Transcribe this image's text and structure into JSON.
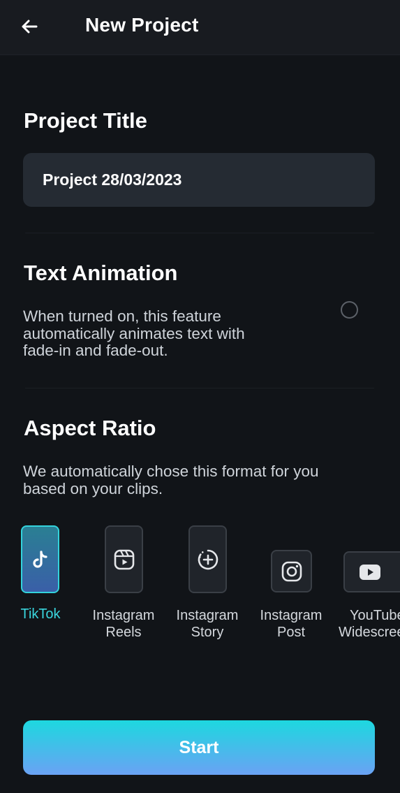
{
  "header": {
    "title": "New Project",
    "back_icon": "arrow-left-icon"
  },
  "project_title": {
    "heading": "Project Title",
    "value": "Project 28/03/2023"
  },
  "text_animation": {
    "heading": "Text Animation",
    "description_lines": [
      "When turned on, this feature",
      "automatically animates text with",
      "fade-in and fade-out."
    ],
    "enabled": false
  },
  "aspect_ratio": {
    "heading": "Aspect Ratio",
    "description_lines": [
      "We automatically chose this format for you",
      "based on your clips."
    ],
    "options": [
      {
        "label_lines": [
          "TikTok"
        ],
        "icon": "tiktok-icon",
        "selected": true
      },
      {
        "label_lines": [
          "Instagram",
          "Reels"
        ],
        "icon": "instagram-reels-icon",
        "selected": false
      },
      {
        "label_lines": [
          "Instagram",
          "Story"
        ],
        "icon": "instagram-story-icon",
        "selected": false
      },
      {
        "label_lines": [
          "Instagram",
          "Post"
        ],
        "icon": "instagram-post-icon",
        "selected": false
      },
      {
        "label_lines": [
          "YouTube",
          "Widescreen"
        ],
        "icon": "youtube-icon",
        "selected": false
      }
    ]
  },
  "start_button": {
    "label": "Start"
  },
  "colors": {
    "background": "#111418",
    "accent": "#33d3dc",
    "input_bg": "#252b33"
  }
}
